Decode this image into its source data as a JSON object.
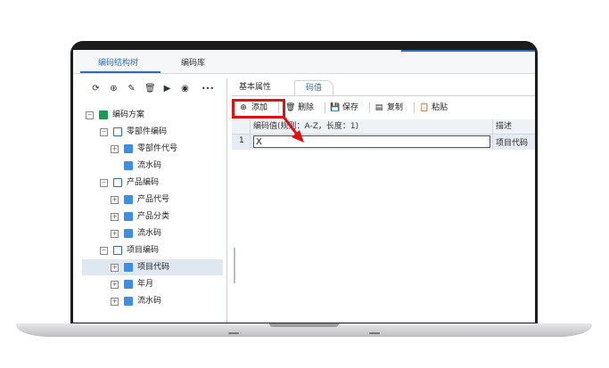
{
  "top_tabs": [
    {
      "label": "编码结构树"
    },
    {
      "label": "编码库"
    }
  ],
  "left_toolbar": {
    "icons": [
      "refresh-icon",
      "add-circle-icon",
      "edit-icon",
      "trash-icon",
      "play-icon",
      "stop-icon",
      "more-icon"
    ],
    "glyphs": [
      "⟳",
      "⊕",
      "✎",
      "🗑",
      "▶",
      "◉",
      "•••"
    ]
  },
  "tree": {
    "items": [
      {
        "label": "编码方案"
      },
      {
        "label": "零部件编码"
      },
      {
        "label": "零部件代号"
      },
      {
        "label": "流水码"
      },
      {
        "label": "产品编码"
      },
      {
        "label": "产品代号"
      },
      {
        "label": "产品分类"
      },
      {
        "label": "流水码"
      },
      {
        "label": "项目编码"
      },
      {
        "label": "项目代码"
      },
      {
        "label": "年月"
      },
      {
        "label": "流水码"
      }
    ],
    "expander_minus": "−",
    "expander_plus": "+"
  },
  "sub_tabs": [
    {
      "label": "基本属性"
    },
    {
      "label": "码值"
    }
  ],
  "toolbar": {
    "add": {
      "glyph": "⊕",
      "label": "添加"
    },
    "delete": {
      "glyph": "🗑",
      "label": "删除"
    },
    "save": {
      "glyph": "💾",
      "label": "保存"
    },
    "copy": {
      "glyph": "▤",
      "label": "复制"
    },
    "paste": {
      "glyph": "📋",
      "label": "粘贴"
    }
  },
  "grid": {
    "columns": [
      "编码值(规则：A-Z，长度：1)",
      "描述"
    ],
    "rows": [
      {
        "num": "1",
        "value": "X",
        "desc": "项目代码"
      }
    ]
  },
  "colors": {
    "accent": "#2f6db5",
    "highlight_red": "#e01010"
  }
}
